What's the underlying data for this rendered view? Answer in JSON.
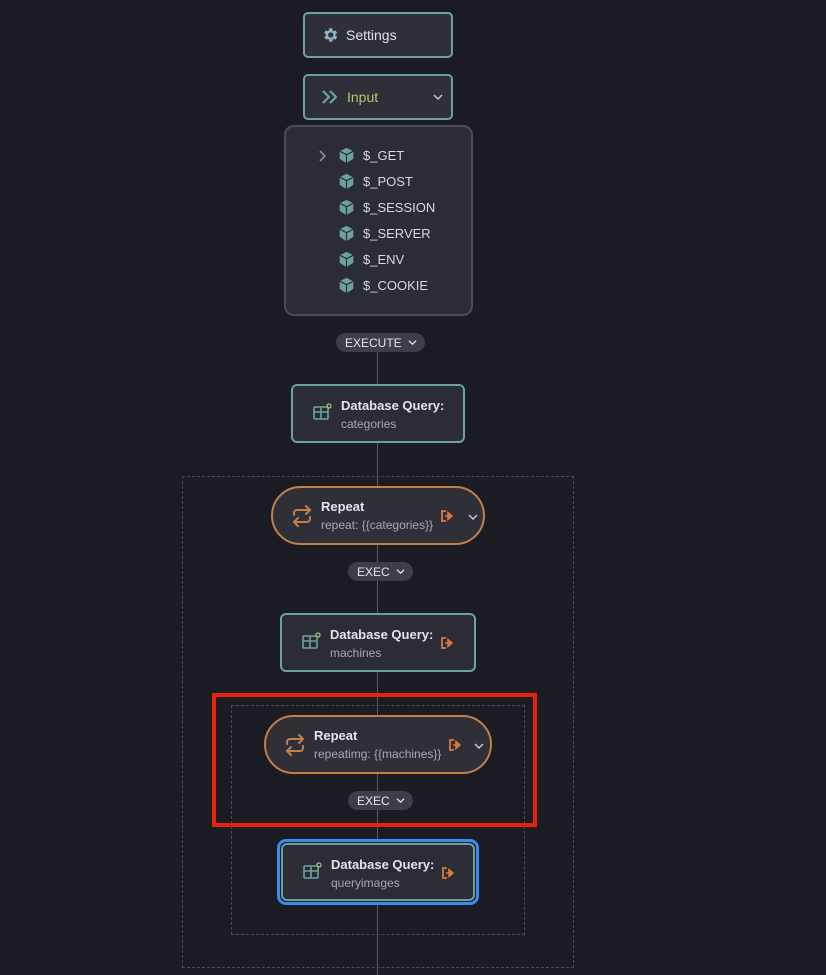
{
  "settings": {
    "label": "Settings",
    "icon": "gear-icon"
  },
  "input": {
    "label": "Input",
    "icon": "double-chevron-right-icon",
    "label_color": "#b6c96a"
  },
  "input_list": {
    "items": [
      {
        "label": "$_GET",
        "expandable": true
      },
      {
        "label": "$_POST"
      },
      {
        "label": "$_SESSION"
      },
      {
        "label": "$_SERVER"
      },
      {
        "label": "$_ENV"
      },
      {
        "label": "$_COOKIE"
      }
    ]
  },
  "execute_pill": {
    "label": "EXECUTE"
  },
  "db_query_1": {
    "title": "Database Query:",
    "subtitle": "categories"
  },
  "repeat_1": {
    "title": "Repeat",
    "subtitle": "repeat: {{categories}}"
  },
  "exec_pill_1": {
    "label": "EXEC"
  },
  "db_query_2": {
    "title": "Database Query:",
    "subtitle": "machines"
  },
  "repeat_2": {
    "title": "Repeat",
    "subtitle": "repeatimg: {{machines}}"
  },
  "exec_pill_2": {
    "label": "EXEC"
  },
  "db_query_3": {
    "title": "Database Query:",
    "subtitle": "queryimages",
    "selected": true
  },
  "colors": {
    "background": "#1b1b23",
    "node_border": "#6aa39d",
    "repeat_border": "#c27f4a",
    "selected_border": "#3b8bf0",
    "highlight": "#e8200c",
    "output_icon": "#d9773c"
  }
}
